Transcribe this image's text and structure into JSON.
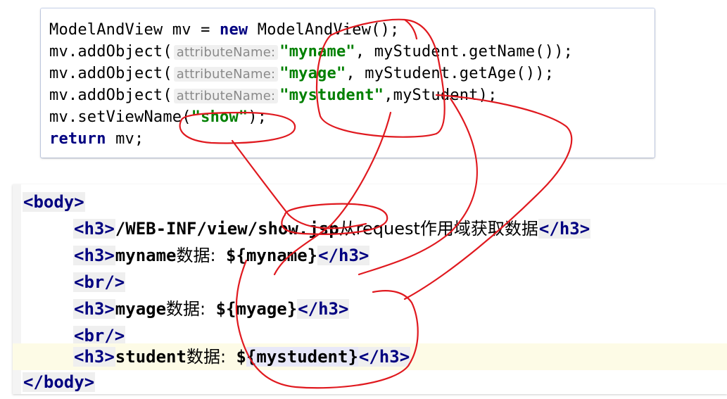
{
  "java_code": {
    "line1": {
      "a": "ModelAndView mv = ",
      "kw": "new",
      "b": " ModelAndView();"
    },
    "line2": {
      "a": "mv.addObject(",
      "hint": "attributeName:",
      "str": "\"myname\"",
      "b": ", myStudent.getName());"
    },
    "line3": {
      "a": "mv.addObject(",
      "hint": "attributeName:",
      "str": "\"myage\"",
      "b": ", myStudent.getAge());"
    },
    "line4": {
      "a": "mv.addObject(",
      "hint": "attributeName:",
      "str": "\"mystudent\"",
      "b": ",myStudent);"
    },
    "line5": {
      "a": "mv.setViewName(",
      "str": "\"show\"",
      "b": ");"
    },
    "line6": {
      "kw": "return",
      "b": " mv;"
    }
  },
  "jsp_code": {
    "body_open": "<body>",
    "h3_open": "<h3>",
    "h3_close": "</h3>",
    "br": "<br/>",
    "body_close": "</body>",
    "line1_text": "/WEB-INF/view/show.jsp",
    "line1_cn": "从request作用域获取数据",
    "line2_text": "myname",
    "line2_cn": "数据:",
    "line2_expr": "${myname}",
    "line4_text": "myage",
    "line4_cn": "数据:",
    "line4_expr": "${myage}",
    "line6_text": "student",
    "line6_cn": "数据:",
    "line6_expr": "${mystudent}"
  },
  "colors": {
    "keyword": "#000080",
    "string": "#008000",
    "annotation_ink": "#e0191f",
    "highlight_line": "#fdfbe6"
  }
}
